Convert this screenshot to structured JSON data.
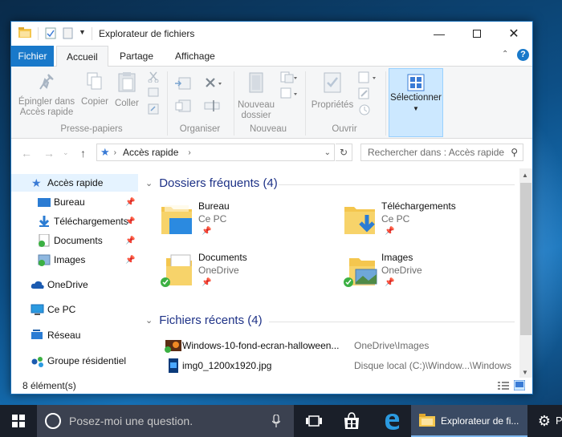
{
  "window": {
    "title": "Explorateur de fichiers"
  },
  "ribbon_tabs": [
    "Fichier",
    "Accueil",
    "Partage",
    "Affichage"
  ],
  "ribbon": {
    "pin": "Épingler dans Accès rapide",
    "pin_l1": "Épingler dans",
    "pin_l2": "Accès rapide",
    "copy": "Copier",
    "paste": "Coller",
    "group_clipboard": "Presse-papiers",
    "group_organize": "Organiser",
    "new_folder_l1": "Nouveau",
    "new_folder_l2": "dossier",
    "group_new": "Nouveau",
    "properties": "Propriétés",
    "group_open": "Ouvrir",
    "select": "Sélectionner"
  },
  "address": {
    "path": "Accès rapide",
    "search_placeholder": "Rechercher dans : Accès rapide"
  },
  "nav_pane": [
    {
      "label": "Accès rapide",
      "icon": "star-icon"
    },
    {
      "label": "Bureau",
      "icon": "desktop-icon",
      "pinned": true
    },
    {
      "label": "Téléchargements",
      "icon": "download-icon",
      "pinned": true
    },
    {
      "label": "Documents",
      "icon": "documents-icon",
      "pinned": true
    },
    {
      "label": "Images",
      "icon": "images-icon",
      "pinned": true
    },
    {
      "label": "OneDrive",
      "icon": "cloud-icon"
    },
    {
      "label": "Ce PC",
      "icon": "pc-icon"
    },
    {
      "label": "Réseau",
      "icon": "network-icon"
    },
    {
      "label": "Groupe résidentiel",
      "icon": "homegroup-icon"
    }
  ],
  "frequent": {
    "header": "Dossiers fréquents (4)",
    "items": [
      {
        "name": "Bureau",
        "location": "Ce PC"
      },
      {
        "name": "Téléchargements",
        "location": "Ce PC"
      },
      {
        "name": "Documents",
        "location": "OneDrive"
      },
      {
        "name": "Images",
        "location": "OneDrive"
      }
    ]
  },
  "recent": {
    "header": "Fichiers récents (4)",
    "items": [
      {
        "name": "Windows-10-fond-ecran-halloween...",
        "location": "OneDrive\\Images"
      },
      {
        "name": "img0_1200x1920.jpg",
        "location": "Disque local (C:)\\Window...\\Windows"
      }
    ]
  },
  "status": {
    "count": "8 élément(s)"
  },
  "taskbar": {
    "search_placeholder": "Posez-moi une question.",
    "explorer_label": "Explorateur de fi...",
    "overflow_label": "P"
  },
  "colors": {
    "accent": "#1979ca",
    "folder": "#f4c64e",
    "header_text": "#1e3287",
    "taskbar": "#1a1f29"
  }
}
